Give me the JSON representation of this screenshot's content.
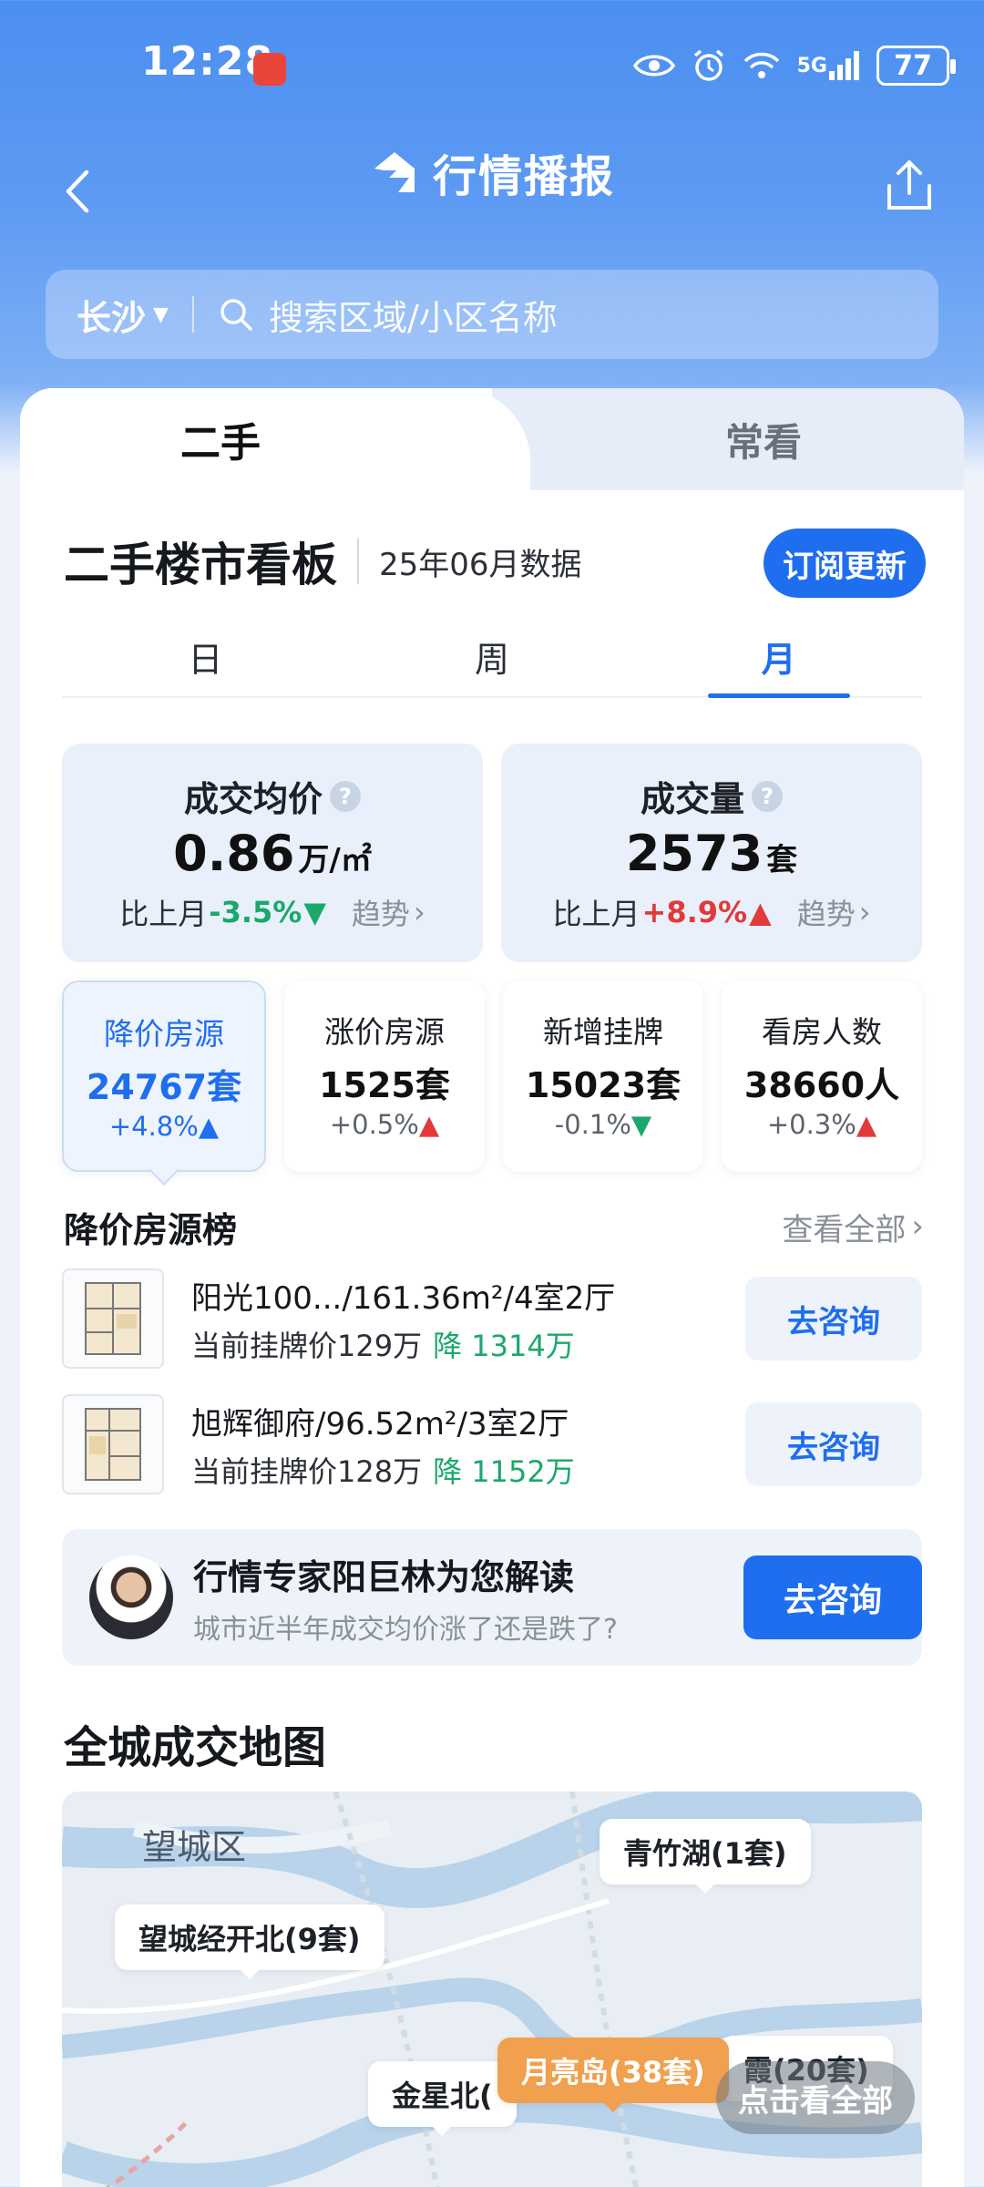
{
  "status_bar": {
    "time": "12:28",
    "network": "5G",
    "battery": "77"
  },
  "header": {
    "title": "行情播报"
  },
  "search": {
    "city": "长沙",
    "placeholder": "搜索区域/小区名称"
  },
  "top_tabs": [
    "二手",
    "常看"
  ],
  "board": {
    "title": "二手楼市看板",
    "data_month": "25年06月数据",
    "subscribe_label": "订阅更新"
  },
  "period_tabs": [
    "日",
    "周",
    "月"
  ],
  "big_stats": [
    {
      "label": "成交均价",
      "value": "0.86",
      "unit": "万/㎡",
      "cmp_label": "比上月",
      "change": "-3.5%",
      "direction": "down",
      "trend_label": "趋势"
    },
    {
      "label": "成交量",
      "value": "2573",
      "unit": "套",
      "cmp_label": "比上月",
      "change": "+8.9%",
      "direction": "up",
      "trend_label": "趋势"
    }
  ],
  "small_stats": [
    {
      "label": "降价房源",
      "value": "24767",
      "unit": "套",
      "change": "+4.8%",
      "direction": "up",
      "selected": true
    },
    {
      "label": "涨价房源",
      "value": "1525",
      "unit": "套",
      "change": "+0.5%",
      "direction": "up"
    },
    {
      "label": "新增挂牌",
      "value": "15023",
      "unit": "套",
      "change": "-0.1%",
      "direction": "down"
    },
    {
      "label": "看房人数",
      "value": "38660",
      "unit": "人",
      "change": "+0.3%",
      "direction": "up"
    }
  ],
  "rank": {
    "title": "降价房源榜",
    "view_all": "查看全部",
    "items": [
      {
        "title": "阳光100.../161.36m²/4室2厅",
        "price_label": "当前挂牌价129万",
        "drop": "降 1314万",
        "consult": "去咨询"
      },
      {
        "title": "旭辉御府/96.52m²/3室2厅",
        "price_label": "当前挂牌价128万",
        "drop": "降 1152万",
        "consult": "去咨询"
      }
    ]
  },
  "expert": {
    "title": "行情专家阳巨林为您解读",
    "subtitle": "城市近半年成交均价涨了还是跌了?",
    "consult": "去咨询"
  },
  "map": {
    "title": "全城成交地图",
    "district": "望城区",
    "pins": [
      "青竹湖(1套)",
      "望城经开北(9套)",
      "月亮岛(38套)",
      "金星北(",
      "霞(20套)"
    ],
    "view_all": "点击看全部"
  },
  "colors": {
    "accent": "#1f6ef0",
    "down": "#1aa86b",
    "up": "#e03a3a",
    "pin_highlight": "#f0a04e"
  }
}
